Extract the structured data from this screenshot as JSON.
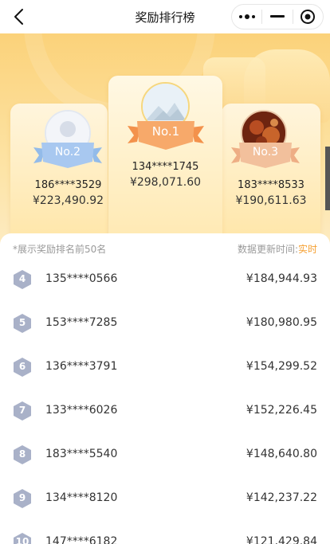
{
  "nav": {
    "title": "奖励排行榜"
  },
  "podium": {
    "first": {
      "rank": "No.1",
      "phone": "134****1745",
      "amount": "¥298,071.60"
    },
    "second": {
      "rank": "No.2",
      "phone": "186****3529",
      "amount": "¥223,490.92"
    },
    "third": {
      "rank": "No.3",
      "phone": "183****8533",
      "amount": "¥190,611.63"
    }
  },
  "list": {
    "hint": "*展示奖励排名前50名",
    "update_label": "数据更新时间:",
    "update_value": "实时",
    "rows": [
      {
        "rank": "4",
        "phone": "135****0566",
        "amount": "¥184,944.93"
      },
      {
        "rank": "5",
        "phone": "153****7285",
        "amount": "¥180,980.95"
      },
      {
        "rank": "6",
        "phone": "136****3791",
        "amount": "¥154,299.52"
      },
      {
        "rank": "7",
        "phone": "133****6026",
        "amount": "¥152,226.45"
      },
      {
        "rank": "8",
        "phone": "183****5540",
        "amount": "¥148,640.80"
      },
      {
        "rank": "9",
        "phone": "134****8120",
        "amount": "¥142,237.22"
      },
      {
        "rank": "10",
        "phone": "147****6182",
        "amount": "¥121,429.84"
      }
    ]
  },
  "colors": {
    "accent": "#f5a032",
    "badge": "#a9b1c8",
    "hero": "#fbd27a"
  }
}
